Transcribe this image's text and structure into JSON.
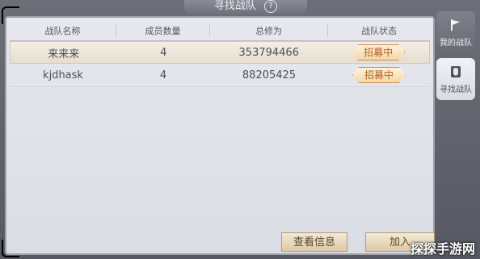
{
  "header": {
    "title": "寻找战队"
  },
  "table": {
    "columns": [
      "战队名称",
      "成员数量",
      "总修为",
      "战队状态"
    ],
    "rows": [
      {
        "name": "来来来",
        "members": "4",
        "power": "353794466",
        "status": "招募中",
        "selected": true
      },
      {
        "name": "kjdhask",
        "members": "4",
        "power": "88205425",
        "status": "招募中",
        "selected": false
      }
    ]
  },
  "side_nav": {
    "items": [
      {
        "label": "我的战队",
        "icon": "team-flag-icon"
      },
      {
        "label": "寻找战队",
        "icon": "search-team-icon"
      }
    ]
  },
  "buttons": {
    "view_info": "查看信息",
    "join": "加入"
  },
  "watermark": "探探手游网"
}
